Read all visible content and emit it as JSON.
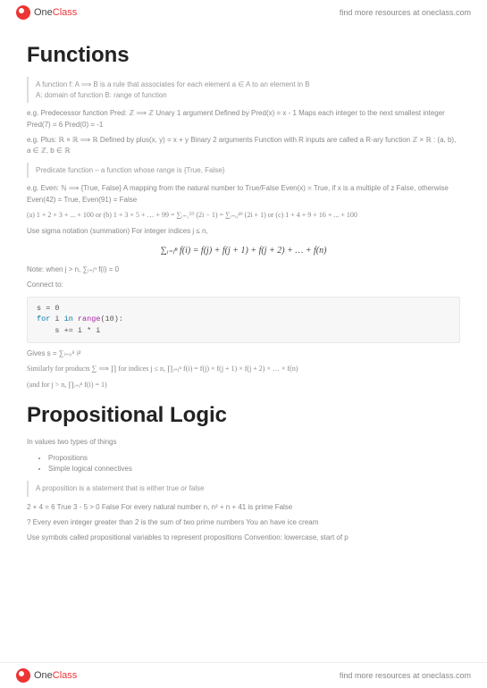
{
  "brand": {
    "name_part1": "One",
    "name_part2": "Class",
    "tagline": "find more resources at oneclass.com"
  },
  "h1_functions": "Functions",
  "quote1": "A function f: A ⟹ B is a rule that associates for each element a ∈ A to an element in B",
  "quote1b": "A: domain of function B: range of function",
  "p_pred": "e.g. Predecessor function  Pred: ℤ ⟹ ℤ  Unary 1 argument  Defined by Pred(x) = x - 1  Maps each integer to the next smallest integer  Pred(7) = 6  Pred(0) = -1",
  "p_plus": "e.g. Plus: ℝ × ℝ ⟹ ℝ  Defined by plus(x, y) = x + y  Binary 2 arguments  Function with R inputs are called a R-ary function  ℤ × ℝ : (a, b), a ∈ ℤ, b ∈ ℝ",
  "quote2": "Predicate function – a function whose range is {True, False}",
  "p_even": "e.g. Even: ℕ ⟹ {True, False}  A mapping from the natural number to True/False  Even(x) = True, if x is a multiple of z  False, otherwise  Even(42) = True, Even(91) = False",
  "p_series": "(a) 1 + 2 + 3 + ... + 100 or (b) 1 + 3 + 5 + … + 99 = ∑ᵢ₌₁⁵⁰ (2i − 1) = ∑ᵢ₌₀⁴⁹ (2i + 1) or (c) 1 + 4 + 9 + 16 + ... + 100",
  "p_sigma": "Use sigma notation (summation) For integer indices j ≤ n,",
  "formula_main": "∑ᵢ₌ⱼⁿ f(i) = f(j) + f(j + 1) + f(j + 2) + … + f(n)",
  "p_note": "Note: when j > n,  ∑ᵢ₌ⱼⁿ f(i) = 0",
  "p_connect": "Connect to:",
  "code": {
    "l1": "s = 0",
    "l2a": "for",
    "l2b": " i ",
    "l2c": "in",
    "l2d": " range",
    "l2e": "(10):",
    "l3": "    s += i * i"
  },
  "p_gives": "Gives s = ∑ᵢ₌₀⁹ i²",
  "p_prod": "Similarly for products ∑ ⟹ ∏ for indices j ≤ n, ∏ᵢ₌ⱼⁿ f(i) = f(j) × f(j + 1) × f(j + 2) × … × f(n)",
  "p_prod2": "(and for j > n, ∏ᵢ₌ⱼⁿ f(i) = 1)",
  "h1_logic": "Propositional Logic",
  "p_values": "In values two types of things",
  "li1": "Propositions",
  "li2": "Simple logical connectives",
  "quote3": "A proposition is a statement that is either true or false",
  "p_examples": "2 + 4 = 6 True 3 - 5 > 0 False For every natural number n, n² + n + 41 is prime False",
  "p_q": "? Every even integer greater than 2 is the sum of two prime numbers You an have ice cream",
  "p_symbols": "Use symbols called propositional variables to represent propositions Convention: lowercase, start of p"
}
